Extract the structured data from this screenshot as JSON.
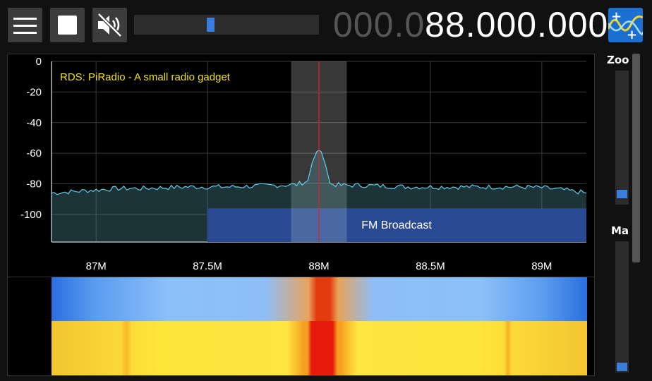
{
  "toolbar": {
    "menu_icon": "hamburger-menu-icon",
    "stop_icon": "stop-icon",
    "mute_icon": "speaker-muted-icon",
    "volume_level": 0.41,
    "frequency_dim": "000.0",
    "frequency_main": "88.000.000",
    "app_icon": "waveform-settings-icon"
  },
  "spectrum": {
    "rds_text": "RDS: PiRadio  - A small radio gadget",
    "band_label": "FM Broadcast",
    "y_ticks": [
      "0",
      "-20",
      "-40",
      "-60",
      "-80",
      "-100"
    ],
    "x_ticks": [
      "87M",
      "87.5M",
      "88M",
      "88.5M",
      "89M"
    ],
    "accent_trace": "#5fd0e8",
    "band_color": "#14228a",
    "center_line_color": "#e02020"
  },
  "chart_data": {
    "type": "line",
    "xlabel": "",
    "ylabel": "",
    "xlim": [
      86.8,
      89.2
    ],
    "ylim": [
      -118,
      0
    ],
    "grid": true,
    "x_ticks": [
      87.0,
      87.5,
      88.0,
      88.5,
      89.0
    ],
    "y_ticks": [
      0,
      -20,
      -40,
      -60,
      -80,
      -100
    ],
    "series": [
      {
        "x": [
          86.8,
          86.9,
          87.0,
          87.1,
          87.2,
          87.3,
          87.4,
          87.5,
          87.6,
          87.7,
          87.8,
          87.9,
          87.95,
          87.97,
          87.99,
          88.0,
          88.01,
          88.03,
          88.05,
          88.1,
          88.2,
          88.3,
          88.4,
          88.5,
          88.6,
          88.7,
          88.8,
          88.9,
          89.0,
          89.1,
          89.2
        ],
        "y": [
          -86,
          -85,
          -84,
          -83,
          -83,
          -82.5,
          -82,
          -82,
          -82,
          -81.5,
          -81,
          -80.5,
          -78,
          -66,
          -59,
          -58,
          -59,
          -68,
          -80,
          -81,
          -81,
          -81.5,
          -82,
          -82,
          -82,
          -82,
          -82,
          -82,
          -82.5,
          -84,
          -86
        ]
      }
    ],
    "highlight_band": [
      87.875,
      88.125
    ],
    "band_region": {
      "label": "FM Broadcast",
      "x": [
        87.5,
        89.2
      ]
    }
  },
  "side": {
    "zoom_label": "Zoo",
    "zoom_level": 0.95,
    "max_label": "Ma",
    "max_level": 1.0
  }
}
